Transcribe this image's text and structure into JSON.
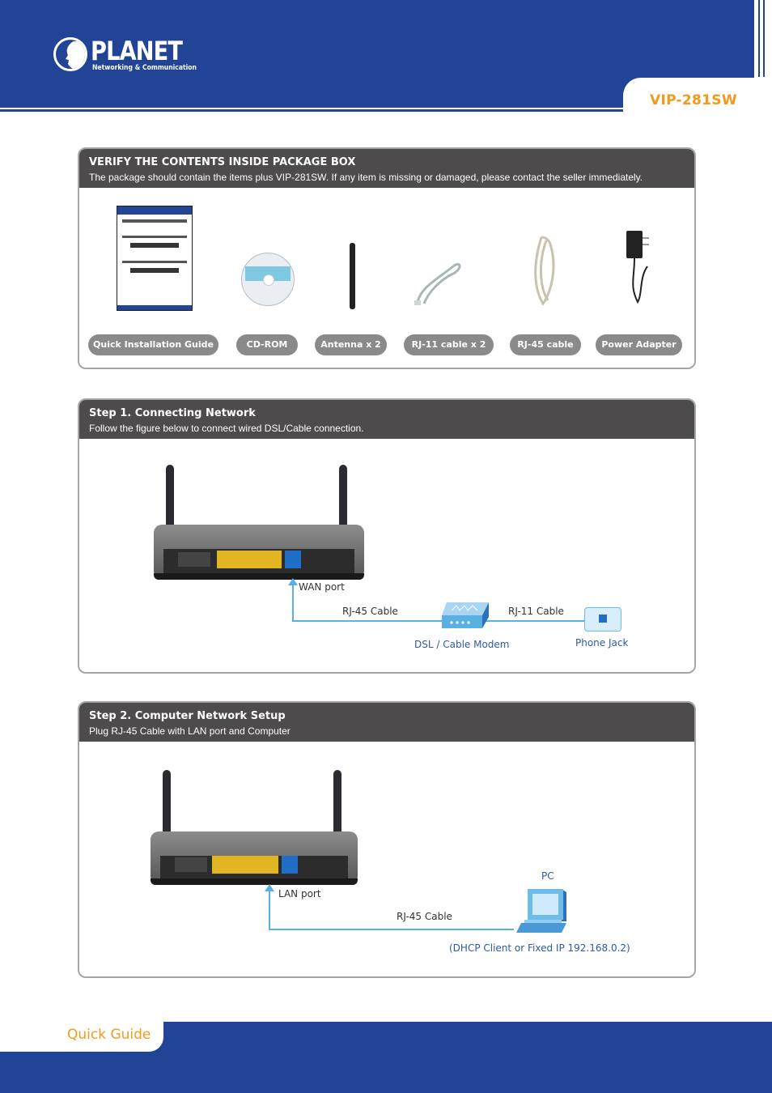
{
  "header": {
    "brand": "PLANET",
    "brand_tagline": "Networking & Communication",
    "model": "VIP-281SW"
  },
  "package": {
    "title": "VERIFY THE CONTENTS INSIDE PACKAGE BOX",
    "subtitle": "The package should contain the items plus VIP-281SW. If any item is missing or damaged, please contact the seller immediately.",
    "items": [
      {
        "label": "Quick Installation Guide",
        "icon": "document-icon"
      },
      {
        "label": "CD-ROM",
        "icon": "cd-icon"
      },
      {
        "label": "Antenna x 2",
        "icon": "antenna-icon"
      },
      {
        "label": "RJ-11 cable x 2",
        "icon": "rj11-cable-icon"
      },
      {
        "label": "RJ-45 cable",
        "icon": "rj45-cable-icon"
      },
      {
        "label": "Power Adapter",
        "icon": "power-adapter-icon"
      }
    ]
  },
  "step1": {
    "title": "Step 1. Connecting Network",
    "subtitle": "Follow the figure below to connect wired DSL/Cable connection.",
    "port_label": "WAN port",
    "cable1": "RJ-45 Cable",
    "cable2": "RJ-11 Cable",
    "modem_label": "DSL / Cable Modem",
    "jack_label": "Phone Jack"
  },
  "step2": {
    "title": "Step 2. Computer Network Setup",
    "subtitle": "Plug RJ-45 Cable with LAN port and Computer",
    "port_label": "LAN port",
    "cable": "RJ-45 Cable",
    "pc_label": "PC",
    "pc_note": "(DHCP Client or Fixed IP 192.168.0.2)"
  },
  "footer": {
    "label": "Quick Guide"
  },
  "colors": {
    "brand_blue": "#214496",
    "accent_orange": "#f29a1c",
    "panel_header": "#4d4b4c",
    "cable_blue": "#5ab0e0",
    "label_blue": "#2d5aa8"
  }
}
